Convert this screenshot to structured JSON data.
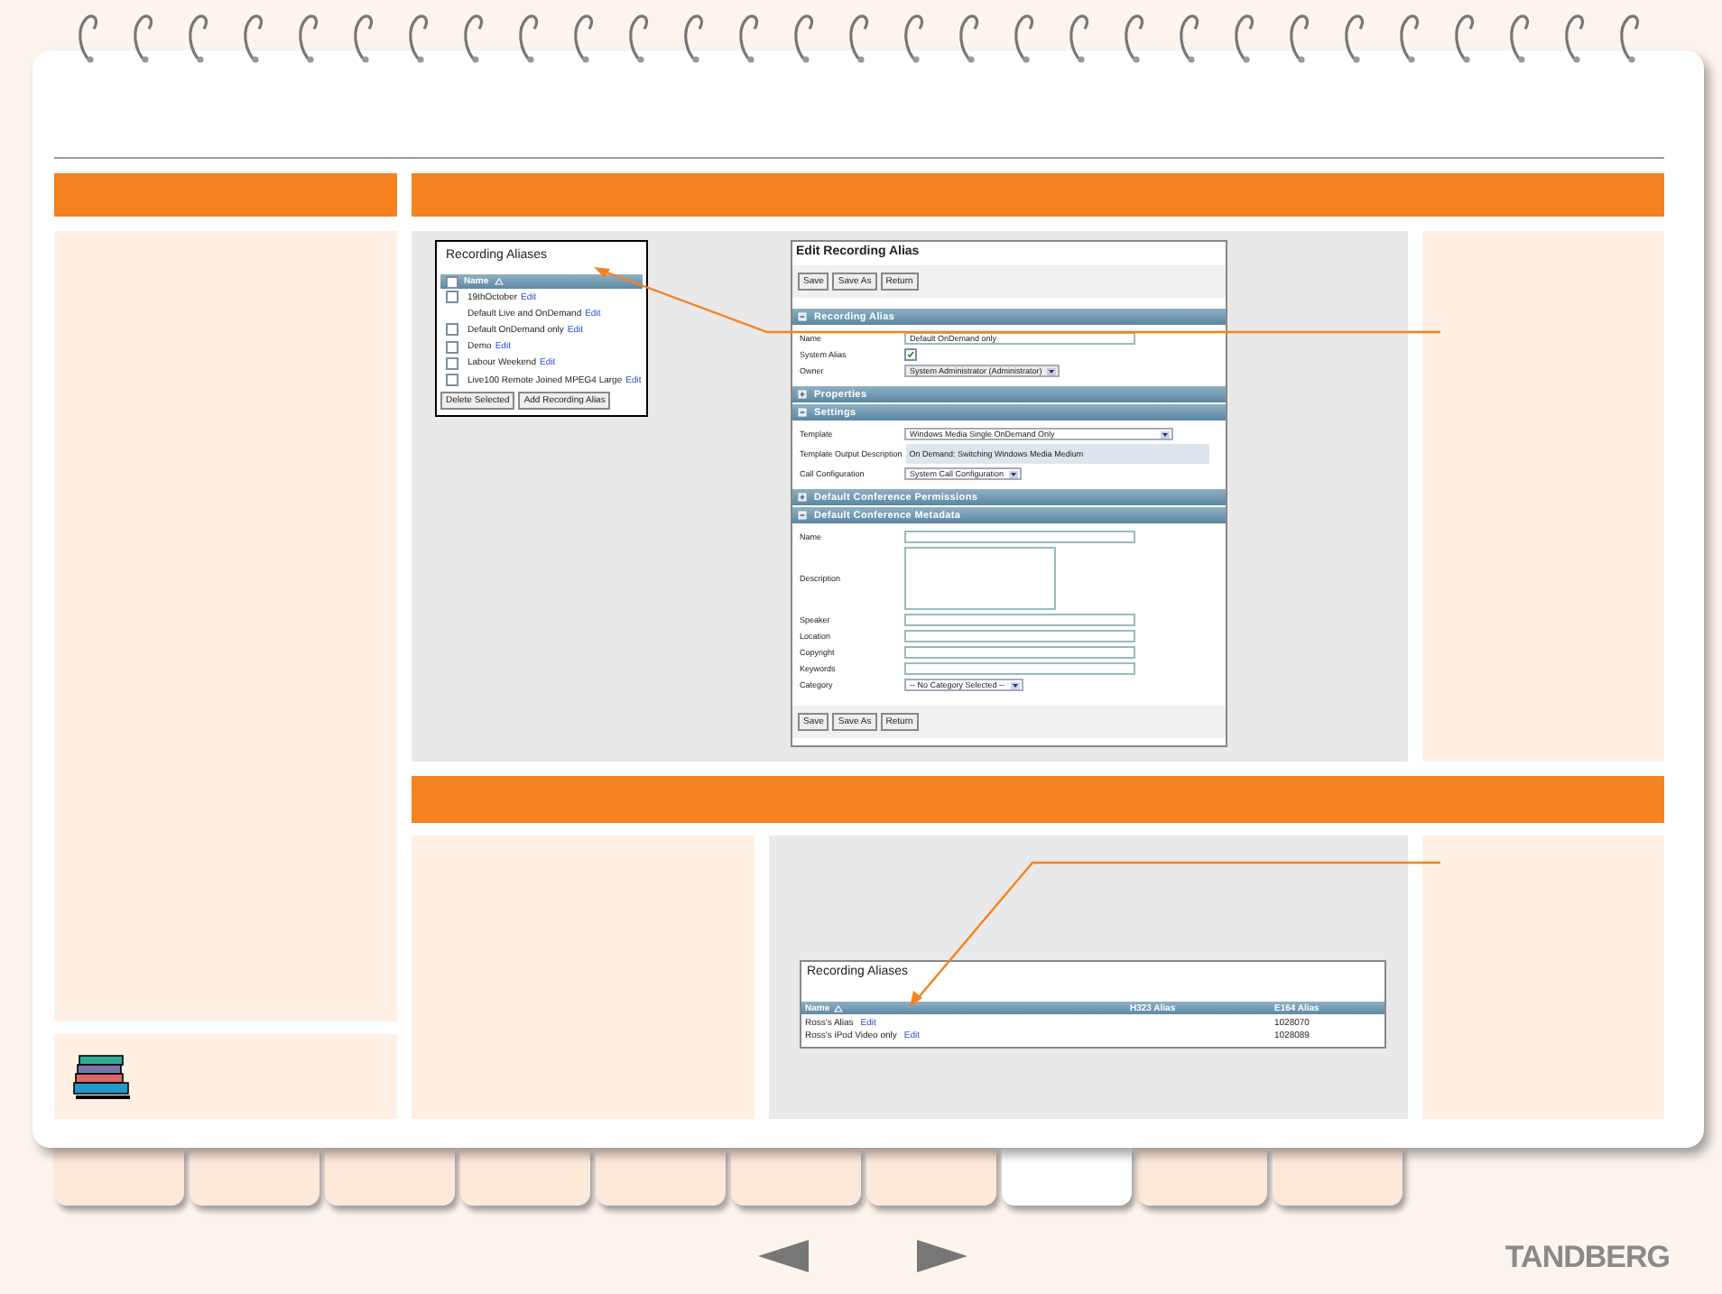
{
  "tabs": [
    {
      "selected": false
    },
    {
      "selected": false
    },
    {
      "selected": false
    },
    {
      "selected": false
    },
    {
      "selected": false
    },
    {
      "selected": false
    },
    {
      "selected": false
    },
    {
      "selected": true
    },
    {
      "selected": false
    },
    {
      "selected": false
    }
  ],
  "alias_list": {
    "title": "Recording Aliases",
    "column": "Name",
    "header_checked": false,
    "rows": [
      {
        "kind": "checkbox",
        "name": "19thOctober",
        "link": "Edit",
        "checked": false
      },
      {
        "kind": "plain",
        "name": "Default Live and OnDemand",
        "link": "Edit"
      },
      {
        "kind": "checkbox",
        "name": "Default OnDemand only",
        "link": "Edit",
        "checked": false
      },
      {
        "kind": "checkbox",
        "name": "Demo",
        "link": "Edit",
        "checked": false
      },
      {
        "kind": "checkbox",
        "name": "Labour Weekend",
        "link": "Edit",
        "checked": false
      },
      {
        "kind": "checkbox",
        "name": "Live100 Remote Joined MPEG4 Large",
        "link": "Edit",
        "checked": false
      }
    ],
    "buttons": [
      "Delete Selected",
      "Add Recording Alias"
    ]
  },
  "edit_form": {
    "title": "Edit Recording Alias",
    "buttons": [
      "Save",
      "Save As",
      "Return"
    ],
    "sections": [
      {
        "title": "Recording Alias",
        "expanded": true,
        "fields": [
          {
            "kind": "text",
            "label": "Name",
            "value": "Default OnDemand only"
          },
          {
            "kind": "checkbox",
            "label": "System Alias",
            "checked": true
          },
          {
            "kind": "select",
            "label": "Owner",
            "value": "System Administrator (Administrator)",
            "disabled": true
          }
        ]
      },
      {
        "title": "Properties",
        "expanded": false
      },
      {
        "title": "Settings",
        "expanded": true,
        "fields": [
          {
            "kind": "dropdown",
            "label": "Template",
            "value": "Windows Media Single OnDemand Only"
          },
          {
            "kind": "note",
            "label": "Template Output Description",
            "value": "On Demand: Switching Windows Media Medium"
          },
          {
            "kind": "select",
            "label": "Call Configuration",
            "value": "System Call Configuration",
            "disabled": false
          }
        ]
      },
      {
        "title": "Default Conference Permissions",
        "expanded": false
      },
      {
        "title": "Default Conference Metadata",
        "expanded": true,
        "fields": [
          {
            "kind": "text",
            "label": "Name"
          },
          {
            "kind": "textarea",
            "label": "Description"
          },
          {
            "kind": "text",
            "label": "Speaker"
          },
          {
            "kind": "text",
            "label": "Location"
          },
          {
            "kind": "text",
            "label": "Copyright"
          },
          {
            "kind": "text",
            "label": "Keywords"
          },
          {
            "kind": "select",
            "label": "Category",
            "value": "-- No Category Selected --",
            "disabled": false
          }
        ]
      }
    ],
    "bottom_buttons": [
      "Save",
      "Save As",
      "Return"
    ]
  },
  "alias_table": {
    "title": "Recording Aliases",
    "columns": [
      "Name",
      "H323 Alias",
      "E164 Alias"
    ],
    "rows": [
      {
        "name": "Ross's Alias",
        "link": "Edit",
        "e164": "1028070"
      },
      {
        "name": "Ross's iPod Video only",
        "link": "Edit",
        "e164": "1028089"
      }
    ]
  },
  "logo": "TANDBERG"
}
